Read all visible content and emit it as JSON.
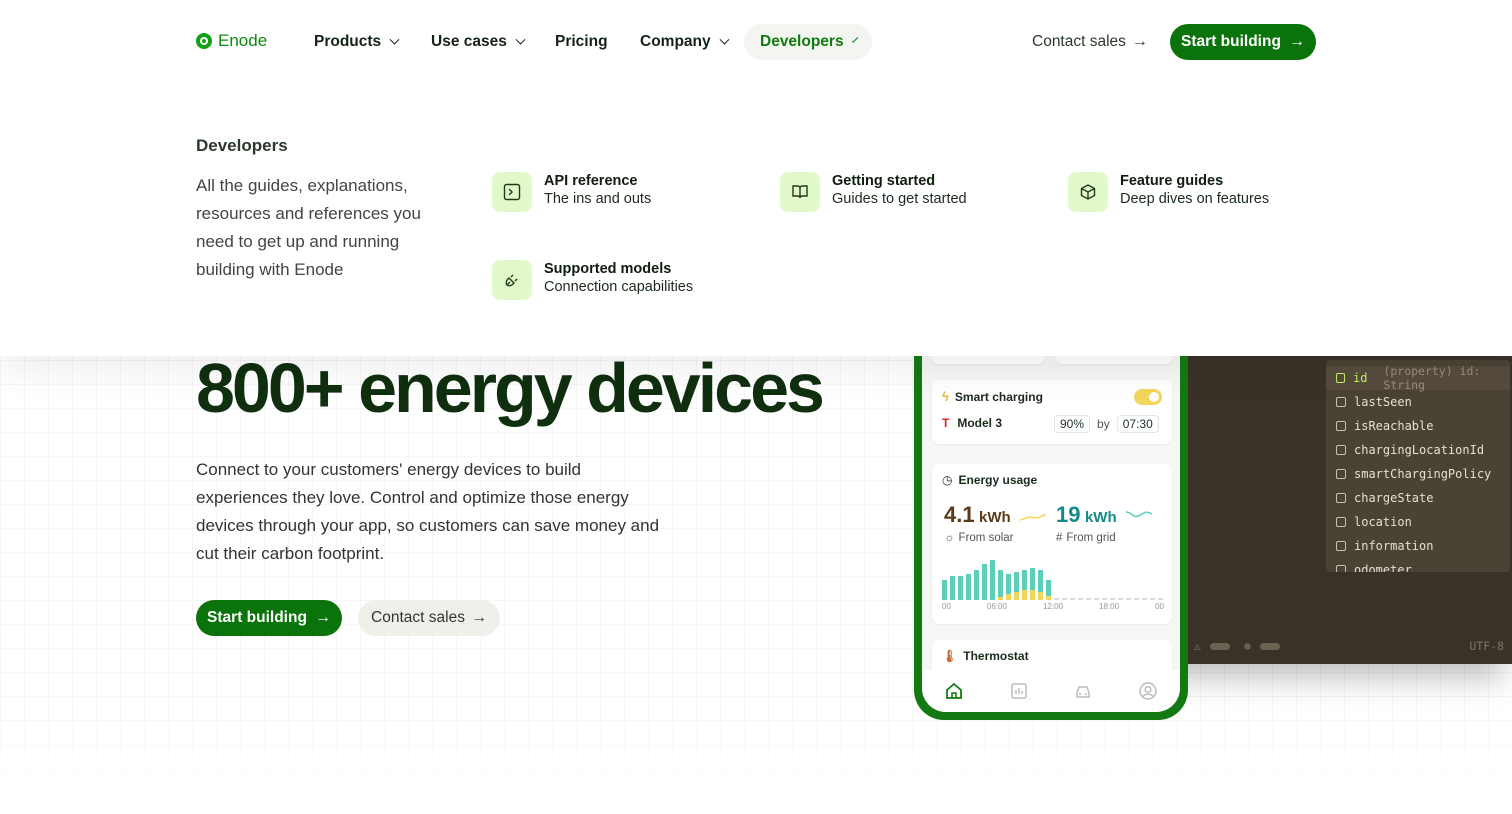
{
  "nav": {
    "logo_text": "Enode",
    "items": [
      {
        "label": "Products",
        "has_dropdown": true
      },
      {
        "label": "Use cases",
        "has_dropdown": true
      },
      {
        "label": "Pricing",
        "has_dropdown": false
      },
      {
        "label": "Company",
        "has_dropdown": true
      },
      {
        "label": "Developers",
        "has_dropdown": true,
        "active": true
      }
    ],
    "contact_sales": "Contact sales",
    "start_building": "Start building"
  },
  "menu": {
    "title": "Developers",
    "description": "All the guides, explanations, resources and references you need to get up and running building with Enode",
    "cards": [
      {
        "title": "API reference",
        "subtitle": "The ins and outs",
        "icon": "terminal-icon"
      },
      {
        "title": "Getting started",
        "subtitle": "Guides to get started",
        "icon": "book-icon"
      },
      {
        "title": "Feature guides",
        "subtitle": "Deep dives on features",
        "icon": "cube-icon"
      },
      {
        "title": "Supported models",
        "subtitle": "Connection capabilities",
        "icon": "plug-icon"
      }
    ]
  },
  "hero": {
    "title": "800+ energy devices",
    "description": "Connect to your customers' energy devices to build experiences they love. Control and optimize those energy devices through your app, so customers can save money and cut their carbon footprint.",
    "primary_cta": "Start building",
    "secondary_cta": "Contact sales"
  },
  "phone": {
    "smart_charging": {
      "title": "Smart charging",
      "vehicle": "Model 3",
      "target": "90%",
      "by": "by",
      "time": "07:30"
    },
    "energy_usage": {
      "title": "Energy usage",
      "solar_value": "4.1",
      "solar_unit": "kWh",
      "solar_label": "From solar",
      "grid_value": "19",
      "grid_unit": "kWh",
      "grid_label": "From grid",
      "axis_labels": [
        "00",
        "06:00",
        "12:00",
        "18:00",
        "00"
      ]
    },
    "thermostat": {
      "title": "Thermostat"
    }
  },
  "code_panel": {
    "properties": [
      "id",
      "lastSeen",
      "isReachable",
      "chargingLocationId",
      "smartChargingPolicy",
      "chargeState",
      "location",
      "information",
      "odometer"
    ],
    "selected_hint": "(property) id: String",
    "encoding": "UTF-8"
  },
  "colors": {
    "brand": "#0b730b",
    "brand_light": "#e2f8c8",
    "solar": "#f2d55a",
    "grid": "#5ecdb9"
  }
}
